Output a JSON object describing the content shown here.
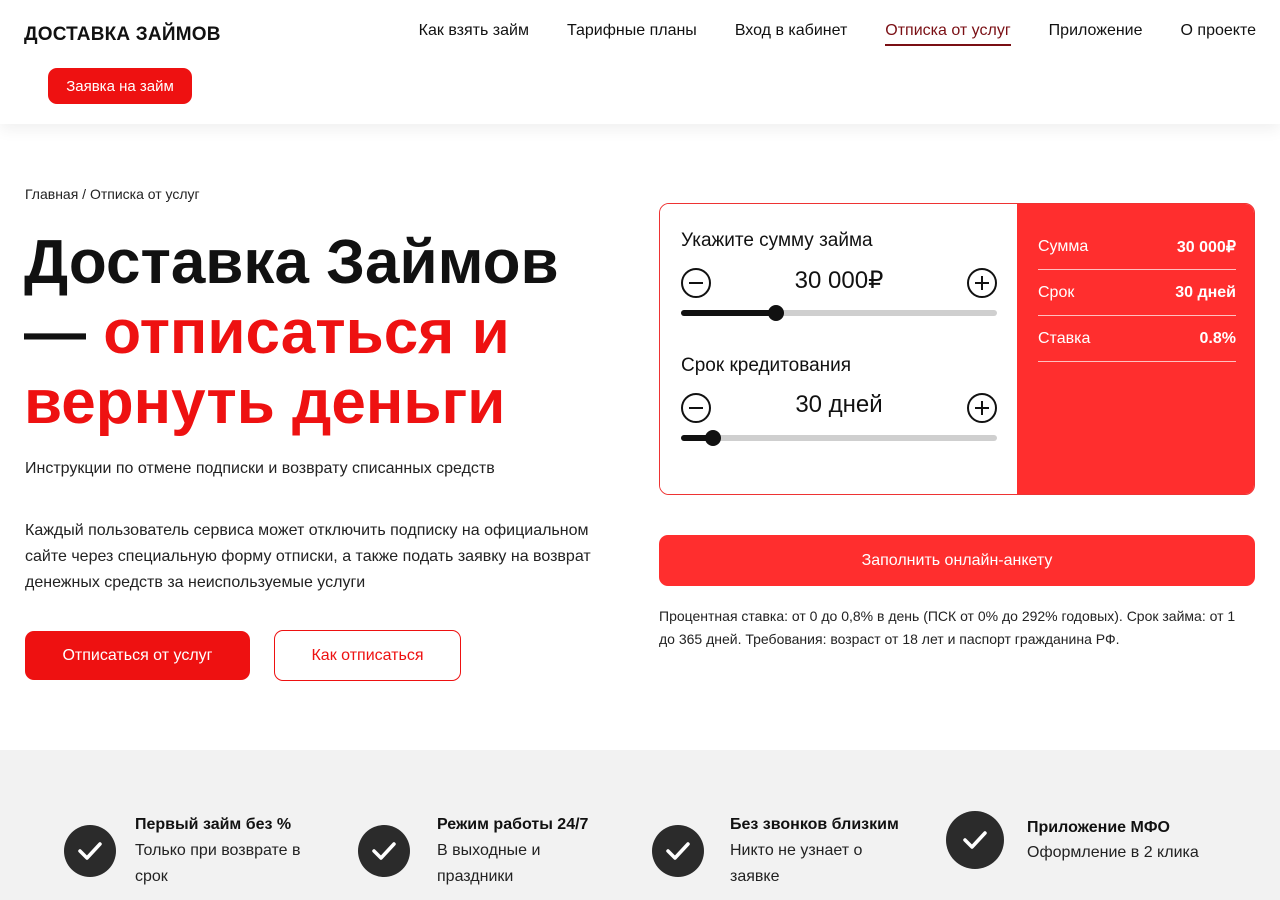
{
  "header": {
    "logo": "ДОСТАВКА ЗАЙМОВ",
    "nav": [
      {
        "label": "Как взять займ"
      },
      {
        "label": "Тарифные планы"
      },
      {
        "label": "Вход в кабинет"
      },
      {
        "label": "Отписка от услуг",
        "active": true
      },
      {
        "label": "Приложение"
      },
      {
        "label": "О проекте"
      }
    ],
    "apply_label": "Заявка на займ"
  },
  "breadcrumb": "Главная / Отписка от услуг",
  "hero": {
    "title_line1": "Доставка Займов",
    "title_dash": "— ",
    "title_accent1": "отписаться и",
    "title_accent2": "вернуть деньги",
    "subtitle": "Инструкции по отмене подписки и возврату списанных средств",
    "description": "Каждый пользователь сервиса может отключить подписку на официальном сайте через специальную форму отписки, а также подать заявку на возврат денежных средств за неиспользуемые услуги",
    "primary_label": "Отписаться от услуг",
    "outline_label": "Как отписаться"
  },
  "calculator": {
    "amount_label": "Укажите сумму займа",
    "amount_value": "30 000₽",
    "amount_fill": 0.3,
    "term_label": "Срок кредитования",
    "term_value": "30 дней",
    "term_fill": 0.1,
    "summary": [
      {
        "label": "Сумма",
        "value": "30 000₽"
      },
      {
        "label": "Срок",
        "value": "30 дней"
      },
      {
        "label": "Ставка",
        "value": "0.8%"
      }
    ],
    "accent_color": "#ff2e2e"
  },
  "form_button_label": "Заполнить онлайн-анкету",
  "terms": "Процентная ставка: от 0 до 0,8% в день (ПСК от 0% до 292% годовых). Срок займа: от 1 до 365 дней. Требования: возраст от 18 лет и паспорт гражданина РФ.",
  "features": [
    {
      "title": "Первый займ без %",
      "desc": "Только при возврате в срок"
    },
    {
      "title": "Режим работы 24/7",
      "desc": "В выходные и праздники"
    },
    {
      "title": "Без звонков близким",
      "desc": "Никто не узнает о заявке"
    },
    {
      "title": "Приложение МФО",
      "desc": "Оформление в 2 клика"
    }
  ],
  "colors": {
    "brand": "#ee1111",
    "dark": "#111111",
    "active_nav": "#7a0f14"
  }
}
